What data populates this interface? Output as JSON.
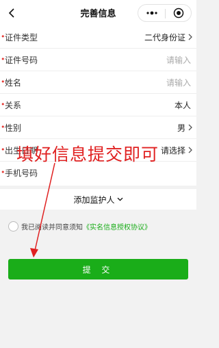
{
  "header": {
    "title": "完善信息"
  },
  "form": {
    "rows": [
      {
        "label": "证件类型",
        "value": "二代身份证",
        "required": true
      },
      {
        "label": "证件号码",
        "value": "请输入",
        "required": true
      },
      {
        "label": "姓名",
        "value": "请输入",
        "required": true
      },
      {
        "label": "关系",
        "value": "本人",
        "required": true
      },
      {
        "label": "性别",
        "value": "男",
        "required": true
      },
      {
        "label": "出生日期",
        "value": "请选择",
        "required": true
      },
      {
        "label": "手机号码",
        "value": "",
        "required": true
      }
    ]
  },
  "guardian": {
    "add_label": "添加监护人"
  },
  "agreement": {
    "text": "我已阅读并同意须知",
    "link": "《实名信息授权协议》"
  },
  "submit": {
    "label": "提 交"
  },
  "annotation": {
    "text": "填好信息提交即可"
  },
  "colors": {
    "accent": "#1aad19",
    "required": "#e53935",
    "annotation": "#e02020"
  },
  "icons": [
    "back-chevron-icon",
    "more-dots-icon",
    "close-target-icon",
    "chevron-right-icon",
    "chevron-down-icon"
  ]
}
